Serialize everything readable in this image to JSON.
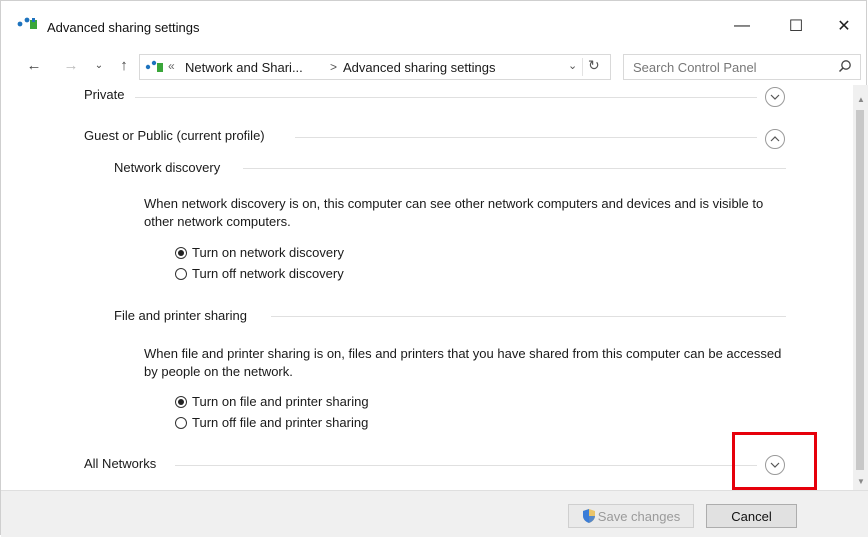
{
  "window": {
    "title": "Advanced sharing settings",
    "controls": {
      "minimize": "—",
      "maximize": "☐",
      "close": "✕"
    }
  },
  "nav": {
    "back": "←",
    "forward": "→",
    "recent": "⌄",
    "up": "↑",
    "address": {
      "chevron": "«",
      "crumb1": "Network and Shari...",
      "separator": ">",
      "crumb2": "Advanced sharing settings",
      "dropdown": "⌄",
      "refresh": "↻"
    },
    "search": {
      "placeholder": "Search Control Panel",
      "icon": "search-icon"
    }
  },
  "sections": {
    "private": {
      "label": "Private",
      "state": "collapsed"
    },
    "guest_public": {
      "label": "Guest or Public (current profile)",
      "state": "expanded",
      "network_discovery": {
        "label": "Network discovery",
        "description": "When network discovery is on, this computer can see other network computers and devices and is visible to other network computers.",
        "options": [
          {
            "label": "Turn on network discovery",
            "selected": true
          },
          {
            "label": "Turn off network discovery",
            "selected": false
          }
        ]
      },
      "file_printer_sharing": {
        "label": "File and printer sharing",
        "description": "When file and printer sharing is on, files and printers that you have shared from this computer can be accessed by people on the network.",
        "options": [
          {
            "label": "Turn on file and printer sharing",
            "selected": true
          },
          {
            "label": "Turn off file and printer sharing",
            "selected": false
          }
        ]
      }
    },
    "all_networks": {
      "label": "All Networks",
      "state": "collapsed"
    }
  },
  "footer": {
    "save_label": "Save changes",
    "cancel_label": "Cancel"
  },
  "colors": {
    "highlight": "#e6000b",
    "accent_blue": "#1e73be",
    "accent_green": "#3aa63a"
  }
}
